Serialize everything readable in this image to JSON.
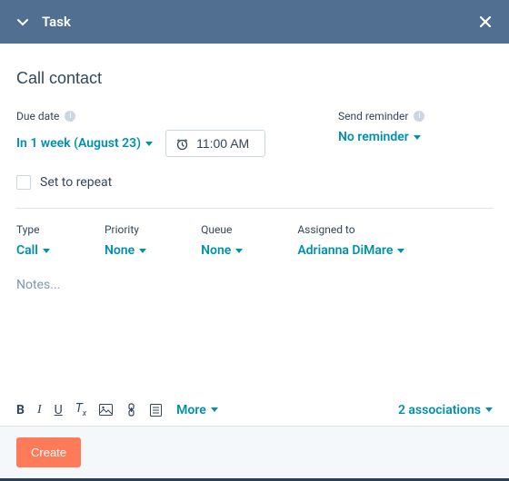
{
  "header": {
    "title": "Task"
  },
  "task": {
    "title": "Call contact"
  },
  "due": {
    "label": "Due date",
    "value": "In 1 week (August 23)",
    "time": "11:00 AM"
  },
  "reminder": {
    "label": "Send reminder",
    "value": "No reminder"
  },
  "repeat": {
    "label": "Set to repeat"
  },
  "type": {
    "label": "Type",
    "value": "Call"
  },
  "priority": {
    "label": "Priority",
    "value": "None"
  },
  "queue": {
    "label": "Queue",
    "value": "None"
  },
  "assigned": {
    "label": "Assigned to",
    "value": "Adrianna DiMare"
  },
  "notes": {
    "placeholder": "Notes..."
  },
  "toolbar": {
    "more": "More"
  },
  "associations": {
    "label": "2 associations"
  },
  "footer": {
    "create": "Create"
  }
}
